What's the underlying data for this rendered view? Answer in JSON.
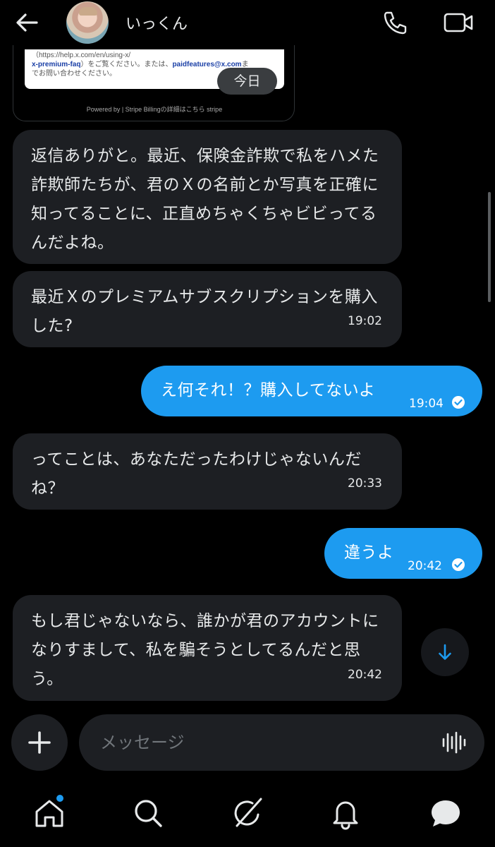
{
  "header": {
    "contact_name": "いっくん"
  },
  "receipt": {
    "line1": "（https://help.x.com/en/using-x/",
    "line2_link": "x-premium-faq",
    "line2_text": "）をご覧ください。または、",
    "line2_email": "paidfeatures@x.com",
    "line2_tail": "ま",
    "line3": "でお問い合わせください。",
    "footer": "Powered by  |  Stripe Billingの詳細はこちら   stripe"
  },
  "date_divider": "今日",
  "messages": [
    {
      "direction": "incoming",
      "text": "返信ありがと。最近、保険金詐欺で私をハメた詐欺師たちが、君のＸの名前とか写真を正確に知ってることに、正直めちゃくちゃビビってるんだよね。",
      "time": ""
    },
    {
      "direction": "incoming",
      "text": "最近Ｘのプレミアムサブスクリプションを購入した?",
      "time": "19:02"
    },
    {
      "direction": "outgoing",
      "text": "え何それ！？購入してないよ",
      "time": "19:04",
      "status": "read"
    },
    {
      "direction": "incoming",
      "text": "ってことは、あなただったわけじゃないんだね？",
      "time": "20:33"
    },
    {
      "direction": "outgoing",
      "text": "違うよ",
      "time": "20:42",
      "status": "read"
    },
    {
      "direction": "incoming",
      "text": "もし君じゃないなら、誰かが君のアカウントになりすまして、私を騙そうとしてるんだと思う。",
      "time": "20:42"
    }
  ],
  "composer": {
    "placeholder": "メッセージ"
  },
  "nav": {
    "items": [
      "home-icon",
      "search-icon",
      "grok-icon",
      "notifications-icon",
      "messages-icon"
    ],
    "home_badge": true
  },
  "colors": {
    "background": "#000000",
    "incoming_bubble": "#1d1f23",
    "outgoing_bubble": "#1d9bf0",
    "accent": "#1d9bf0"
  }
}
